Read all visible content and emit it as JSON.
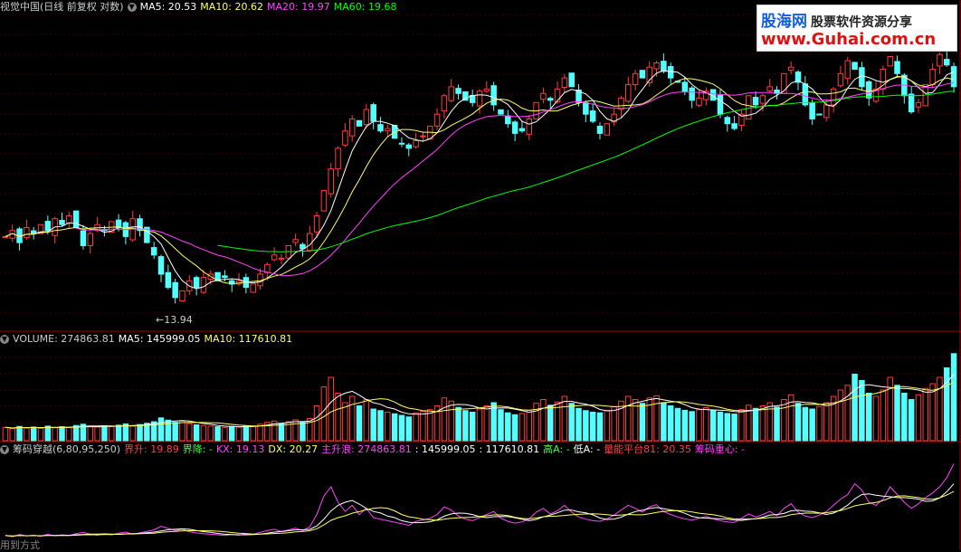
{
  "price_header": {
    "title": "视觉中国(日线 前复权 对数)",
    "ma5": "MA5: 20.53",
    "ma10": "MA10: 20.62",
    "ma20": "MA20: 19.97",
    "ma60": "MA60: 19.68"
  },
  "low_label": "←13.94",
  "volume_header": {
    "title": "VOLUME: 274863.81",
    "ma5": "MA5: 145999.05",
    "ma10": "MA10: 117610.81"
  },
  "indicator_header": {
    "title": "筹码穿越(6,80,95,250)",
    "jiesheng": "界升: 19.89",
    "jiejiang": "界降: -",
    "kx": "KX: 19.13",
    "dx": "DX: 20.27",
    "zhushenglang": "主升浪: 274863.81",
    "v1": ": 145999.05",
    "v2": ": 117610.81",
    "gaoa": "高A: -",
    "dia": "低A: -",
    "lingpingtai": "量能平台81: 20.35",
    "zhongxin": "筹码重心: -"
  },
  "watermark": {
    "brand": "股海网",
    "slogan": "股票软件资源分享",
    "url": "www.Guhai.com.cn"
  },
  "bottom_text": "用到方式",
  "colors": {
    "up": "#ff3c3c",
    "down": "#54ffff",
    "ma5": "#ffffff",
    "ma10": "#ffff66",
    "ma20": "#ff40ff",
    "ma60": "#00ff00"
  },
  "chart_data": {
    "type": "candlestick",
    "price_range": [
      13.5,
      25.5
    ],
    "y_scale": "log",
    "low_marker": 13.94,
    "closes": [
      16.2,
      16.4,
      16.0,
      16.5,
      16.3,
      16.6,
      16.4,
      16.8,
      16.6,
      16.9,
      16.5,
      15.9,
      16.3,
      16.6,
      16.4,
      16.7,
      16.5,
      16.2,
      16.8,
      16.4,
      16.0,
      15.6,
      15.0,
      14.6,
      14.3,
      14.5,
      14.8,
      14.6,
      14.9,
      15.0,
      14.8,
      14.9,
      14.7,
      14.8,
      14.6,
      14.7,
      15.0,
      15.3,
      15.6,
      15.5,
      15.9,
      16.1,
      15.8,
      16.3,
      16.9,
      17.8,
      18.6,
      19.4,
      20.1,
      20.6,
      20.3,
      21.0,
      20.5,
      20.1,
      20.2,
      19.8,
      19.6,
      19.4,
      19.7,
      19.9,
      20.3,
      20.8,
      21.6,
      22.0,
      21.7,
      21.4,
      21.3,
      21.8,
      21.9,
      21.2,
      20.8,
      20.4,
      20.0,
      20.1,
      20.6,
      21.3,
      21.7,
      21.4,
      21.9,
      22.4,
      22.0,
      21.3,
      20.8,
      20.5,
      20.0,
      20.4,
      20.8,
      21.5,
      22.1,
      22.6,
      22.4,
      22.9,
      23.1,
      22.7,
      22.4,
      22.2,
      21.8,
      21.4,
      21.5,
      21.8,
      21.4,
      20.8,
      20.4,
      20.2,
      20.8,
      21.6,
      21.2,
      21.6,
      22.0,
      21.7,
      22.6,
      22.9,
      22.2,
      21.2,
      20.6,
      20.8,
      21.2,
      21.9,
      22.6,
      23.2,
      22.8,
      22.0,
      21.5,
      21.9,
      22.8,
      23.4,
      22.6,
      21.6,
      20.9,
      21.3,
      22.1,
      22.8,
      23.5,
      23.0,
      22.0
    ],
    "volume_range": [
      0,
      300000
    ],
    "volumes": [
      42000,
      38000,
      45000,
      40000,
      43000,
      39000,
      46000,
      41000,
      44000,
      42000,
      48000,
      52000,
      46000,
      43000,
      47000,
      44000,
      49000,
      53000,
      46000,
      51000,
      55000,
      60000,
      72000,
      65000,
      58000,
      62000,
      54000,
      50000,
      48000,
      46000,
      44000,
      42000,
      45000,
      43000,
      47000,
      46000,
      52000,
      58000,
      62000,
      55000,
      60000,
      66000,
      58000,
      70000,
      110000,
      170000,
      200000,
      150000,
      120000,
      140000,
      110000,
      130000,
      100000,
      95000,
      90000,
      85000,
      80000,
      75000,
      88000,
      92000,
      98000,
      110000,
      135000,
      125000,
      105000,
      95000,
      90000,
      100000,
      110000,
      120000,
      98000,
      88000,
      82000,
      86000,
      96000,
      118000,
      130000,
      112000,
      122000,
      140000,
      118000,
      102000,
      95000,
      90000,
      88000,
      96000,
      108000,
      125000,
      140000,
      130000,
      118000,
      135000,
      142000,
      120000,
      110000,
      102000,
      96000,
      92000,
      98000,
      104000,
      96000,
      90000,
      86000,
      84000,
      98000,
      112000,
      102000,
      110000,
      120000,
      106000,
      130000,
      145000,
      118000,
      105000,
      100000,
      108000,
      120000,
      140000,
      160000,
      175000,
      210000,
      190000,
      150000,
      140000,
      160000,
      200000,
      175000,
      150000,
      130000,
      145000,
      165000,
      180000,
      200000,
      230000,
      274863.81
    ],
    "series": [
      {
        "name": "MA5",
        "value": 20.53
      },
      {
        "name": "MA10",
        "value": 20.62
      },
      {
        "name": "MA20",
        "value": 19.97
      },
      {
        "name": "MA60",
        "value": 19.68
      }
    ]
  }
}
